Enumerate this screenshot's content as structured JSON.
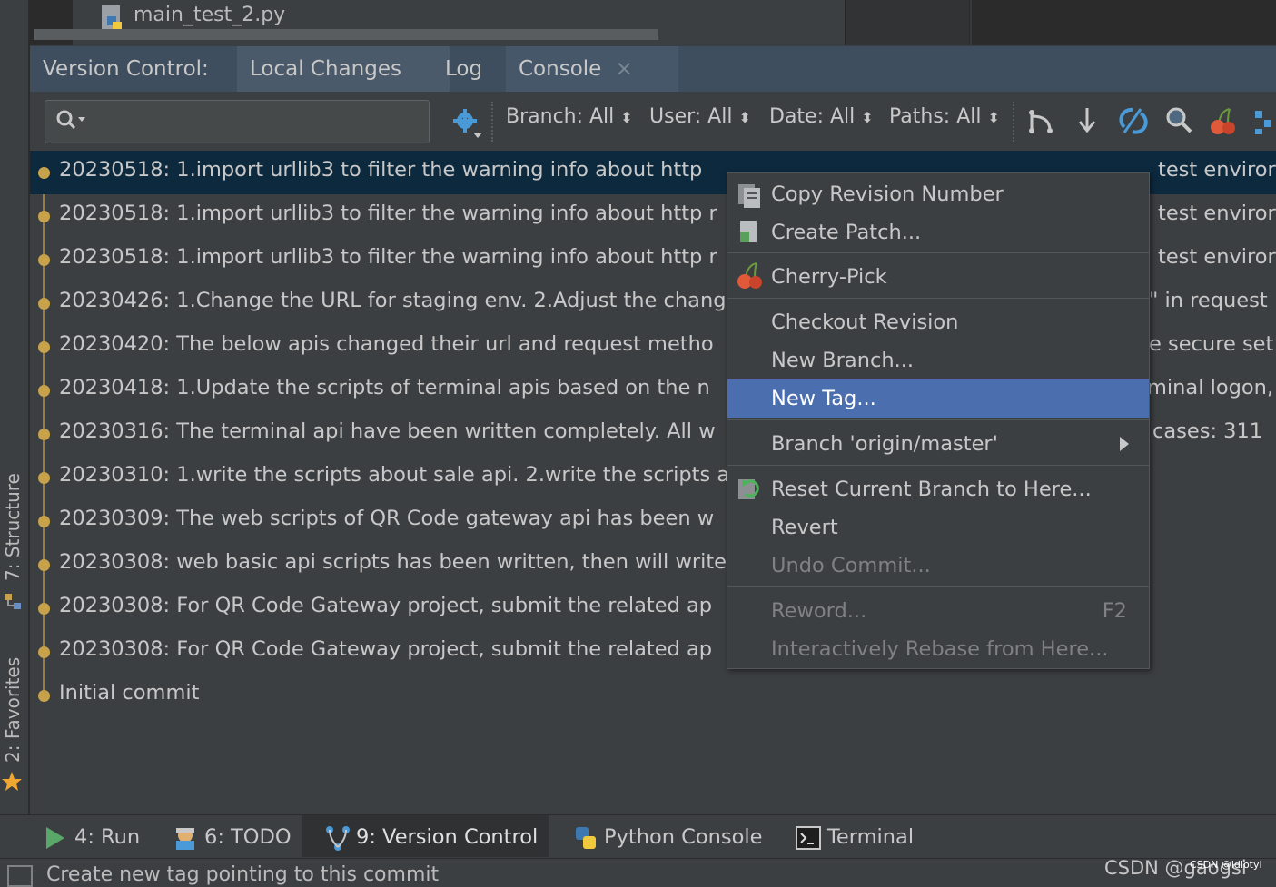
{
  "editor": {
    "file_name": "main_test_2.py"
  },
  "vc_tabs": {
    "prefix": "Version Control:",
    "items": [
      {
        "label": "Local Changes"
      },
      {
        "label": "Log"
      },
      {
        "label": "Console"
      }
    ],
    "close_glyph": "×"
  },
  "toolbar": {
    "search_placeholder": "",
    "filters": [
      {
        "label": "Branch: All"
      },
      {
        "label": "User: All"
      },
      {
        "label": "Date: All"
      },
      {
        "label": "Paths: All"
      }
    ],
    "filter_arrow": "⬍",
    "icons": [
      "settings-icon",
      "branch-graph-icon",
      "update-icon",
      "refresh-icon",
      "search-icon",
      "cherry-pick-icon",
      "layout-icon"
    ]
  },
  "log": {
    "commits": [
      {
        "left": "20230518: 1.import urllib3 to filter the warning info about http ",
        "right": "test enviror",
        "selected": true
      },
      {
        "left": "20230518: 1.import urllib3 to filter the warning info about http r",
        "right": "test enviror"
      },
      {
        "left": "20230518: 1.import urllib3 to filter the warning info about http r",
        "right": "test enviror"
      },
      {
        "left": "20230426: 1.Change the URL for staging env. 2.Adjust the chang",
        "right": "\" in request"
      },
      {
        "left": "20230420: The below apis changed their url and request metho",
        "right": "e secure set"
      },
      {
        "left": "20230418: 1.Update the scripts of terminal apis based on the n",
        "right": "minal logon,"
      },
      {
        "left": "20230316: The terminal api have been written completely. All w",
        "right": "cases: 311"
      },
      {
        "left": "20230310: 1.write the scripts about sale api. 2.write the scripts a",
        "right": ""
      },
      {
        "left": "20230309: The web scripts of QR Code gateway api has been w",
        "right": ""
      },
      {
        "left": "20230308: web basic api scripts has been written, then will write",
        "right": ""
      },
      {
        "left": "20230308: For QR Code Gateway project, submit the related ap",
        "right": ""
      },
      {
        "left": "20230308: For QR Code Gateway project, submit the related ap",
        "right": ""
      },
      {
        "left": "Initial commit",
        "right": ""
      }
    ]
  },
  "context_menu": {
    "items": [
      {
        "label": "Copy Revision Number",
        "icon": "copy-icon"
      },
      {
        "label": "Create Patch...",
        "icon": "patch-icon"
      },
      {
        "label": "Cherry-Pick",
        "icon": "cherry-icon"
      },
      {
        "label": "Checkout Revision"
      },
      {
        "label": "New Branch..."
      },
      {
        "label": "New Tag...",
        "active": true
      },
      {
        "label": "Branch 'origin/master'",
        "submenu": true
      },
      {
        "label": "Reset Current Branch to Here...",
        "icon": "reset-icon"
      },
      {
        "label": "Revert"
      },
      {
        "label": "Undo Commit...",
        "disabled": true
      },
      {
        "label": "Reword...",
        "disabled": true,
        "shortcut": "F2"
      },
      {
        "label": "Interactively Rebase from Here...",
        "disabled": true
      }
    ]
  },
  "side_tools": {
    "structure": "7: Structure",
    "favorites": "2: Favorites"
  },
  "bottom_tools": {
    "run": "4: Run",
    "todo": "6: TODO",
    "version_control": "9: Version Control",
    "python_console": "Python Console",
    "terminal": "Terminal"
  },
  "status": {
    "text": "Create new tag pointing to this commit"
  },
  "watermark": {
    "text": "CSDN @gaogsi",
    "small": "CSDN @idiotyi"
  },
  "colors": {
    "accent": "#4b6eaf",
    "selected_row": "#0d293e",
    "graph": "#c8a24a",
    "panel": "#3c3f41"
  }
}
